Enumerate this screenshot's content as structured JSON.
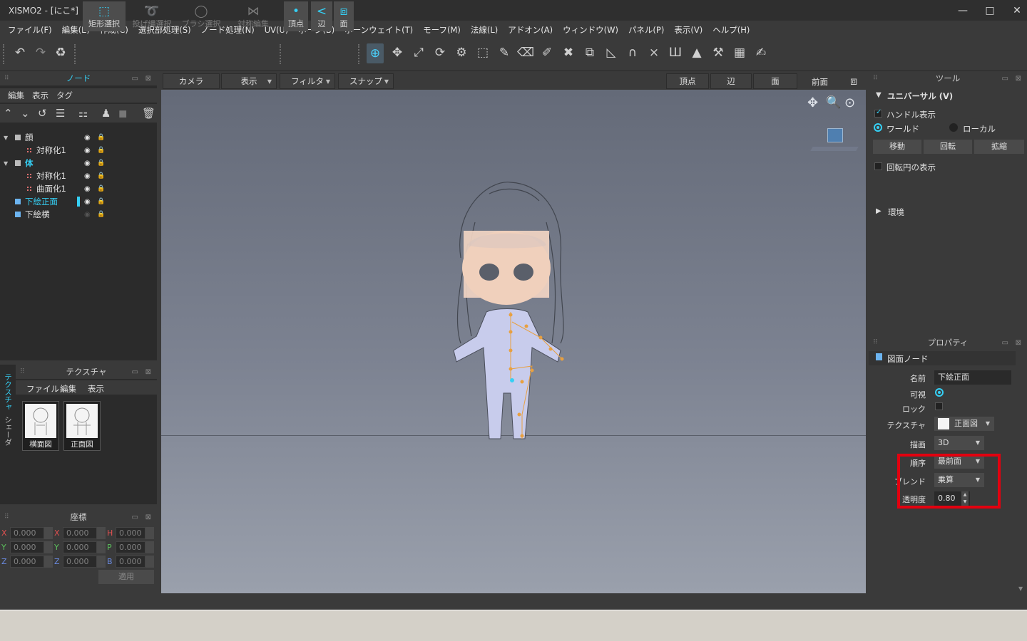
{
  "window": {
    "title": "XISMO2 - [にこ*]",
    "minimize": "—",
    "maximize": "□",
    "close": "✕"
  },
  "menu": [
    "ファイル(F)",
    "編集(E)",
    "作成(C)",
    "選択部処理(S)",
    "ノード処理(N)",
    "UV(U)",
    "ボーン(B)",
    "ボーンウェイト(T)",
    "モーフ(M)",
    "法線(L)",
    "アドオン(A)",
    "ウィンドウ(W)",
    "パネル(P)",
    "表示(V)",
    "ヘルプ(H)"
  ],
  "toolbar": {
    "rect_select": "矩形選択",
    "lasso_select": "投げ縄選択",
    "brush_select": "ブラシ選択",
    "symmetry_edit": "対称編集",
    "vertex": "頂点",
    "edge": "辺",
    "face": "面"
  },
  "node_panel": {
    "title": "ノード",
    "menu": [
      "編集",
      "表示",
      "タグ"
    ],
    "tree": [
      {
        "label": "顔",
        "sub": "対称化1"
      },
      {
        "label": "体",
        "subs": [
          "対称化1",
          "曲面化1"
        ]
      },
      {
        "label": "下絵正面"
      },
      {
        "label": "下絵横"
      }
    ]
  },
  "viewport": {
    "camera": "カメラ",
    "display": "表示",
    "filter": "フィルタ",
    "snap": "スナップ",
    "vertex": "頂点",
    "edge": "辺",
    "face": "面",
    "view_name": "前面"
  },
  "texture_panel": {
    "title": "テクスチャ",
    "menu": [
      "ファイル",
      "編集",
      "表示"
    ],
    "side_tabs": [
      "テクスチャ",
      "シェーダ"
    ],
    "thumbs": [
      "横面図",
      "正面図"
    ]
  },
  "coord_panel": {
    "title": "座標",
    "rows": [
      {
        "a": "X",
        "av": "0.000",
        "b": "X",
        "bv": "0.000",
        "c": "H",
        "cv": "0.000"
      },
      {
        "a": "Y",
        "av": "0.000",
        "b": "Y",
        "bv": "0.000",
        "c": "P",
        "cv": "0.000"
      },
      {
        "a": "Z",
        "av": "0.000",
        "b": "Z",
        "bv": "0.000",
        "c": "B",
        "cv": "0.000"
      }
    ],
    "apply": "適用"
  },
  "tool_panel": {
    "title": "ツール",
    "section": "ユニバーサル (V)",
    "handle_display": "ハンドル表示",
    "world": "ワールド",
    "local": "ローカル",
    "move": "移動",
    "rotate": "回転",
    "scale": "拡縮",
    "rotation_circle": "回転円の表示",
    "environment": "環境"
  },
  "property_panel": {
    "title": "プロパティ",
    "node_type": "図面ノード",
    "name_label": "名前",
    "name_value": "下絵正面",
    "visible_label": "可視",
    "lock_label": "ロック",
    "texture_label": "テクスチャ",
    "texture_value": "正面図",
    "draw_label": "描画",
    "draw_value": "3D",
    "order_label": "順序",
    "order_value": "最前面",
    "blend_label": "ブレンド",
    "blend_value": "乗算",
    "opacity_label": "透明度",
    "opacity_value": "0.80"
  }
}
